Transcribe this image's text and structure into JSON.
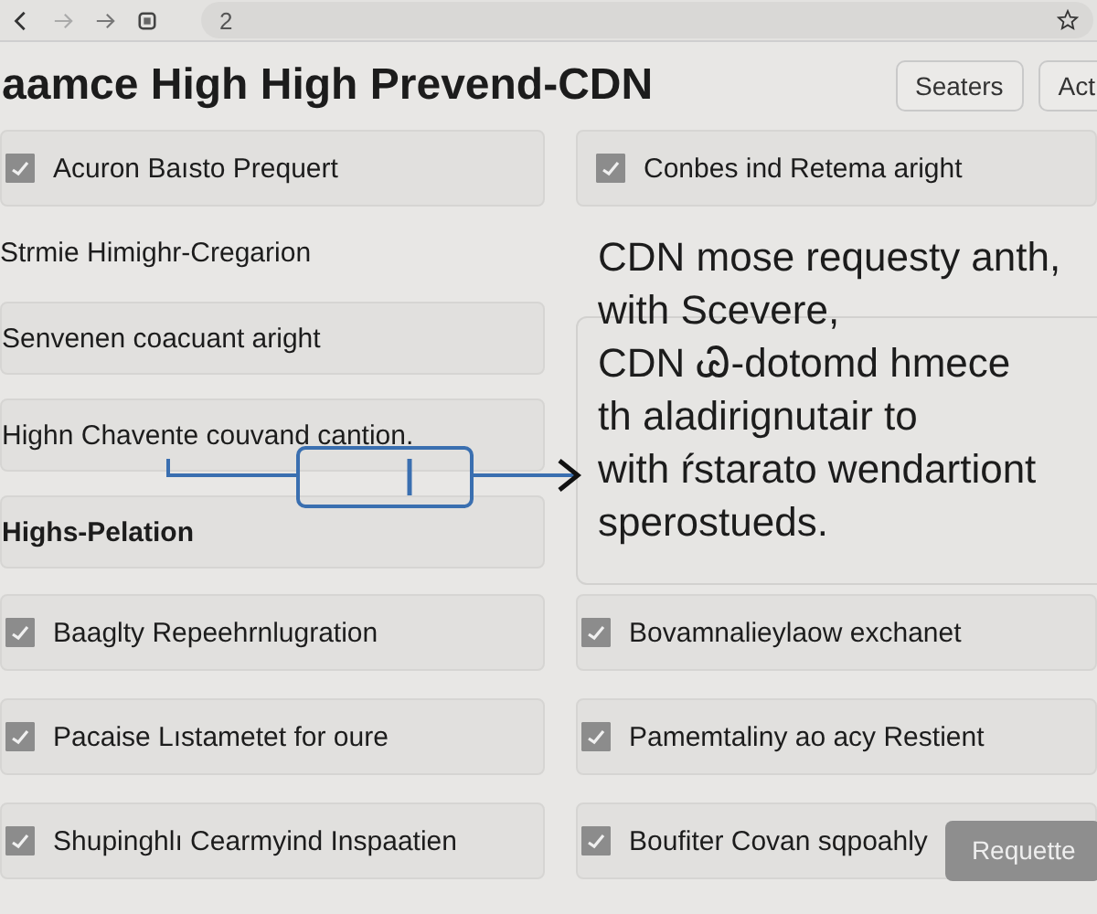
{
  "browser": {
    "address": "2"
  },
  "page": {
    "title": "aamce High High Prevend-CDN",
    "actions": [
      "Seaters",
      "Act"
    ]
  },
  "left_items": [
    {
      "kind": "check",
      "label": "Acuron Baısto Prequert",
      "checked": true
    },
    {
      "kind": "plain",
      "label": "Strmie Himighr-Cregarion"
    },
    {
      "kind": "box",
      "label": "Senvenen coacuant aright"
    },
    {
      "kind": "box",
      "label": "Highn Chavente couvand cantion."
    },
    {
      "kind": "bold",
      "label": "Highs-Pelation"
    }
  ],
  "right_item": {
    "label": "Conbes ind Retema aright",
    "checked": true
  },
  "note_lines": [
    "CDN mose requesty anth,",
    "with Scevere,",
    "CDN Ꮚ-dotomd hmece",
    "th aladirignutair to",
    "with ŕstarato wendartiont",
    "sperostueds."
  ],
  "bottom_rows": [
    {
      "label": "Baaglty Repeehrnlugration",
      "checked": true
    },
    {
      "label": "Bovamnalieylaow exchanet",
      "checked": true
    },
    {
      "label": "Pacaise Lıstametet for oure",
      "checked": true
    },
    {
      "label": "Pamemtaliny ao acy Restient",
      "checked": true
    },
    {
      "label": "Shupinghlı Cearmyind Inspaatien",
      "checked": true
    },
    {
      "label": "Boufiter Covan sqpoahly",
      "checked": true
    }
  ],
  "request_button": "Requette"
}
